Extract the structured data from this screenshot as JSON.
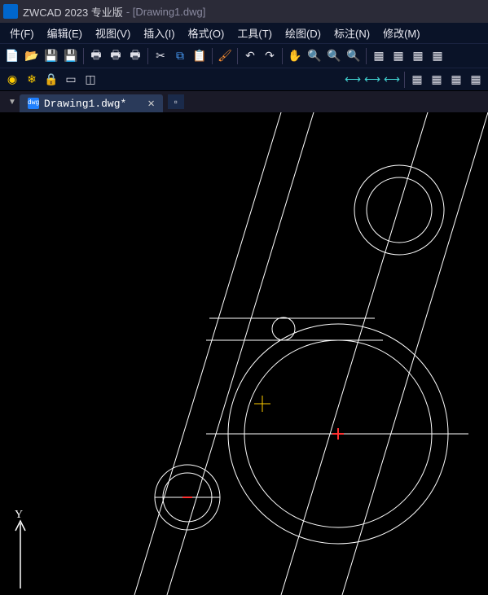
{
  "app": {
    "title": "ZWCAD 2023 专业版",
    "document_suffix": "- [Drawing1.dwg]"
  },
  "menus": [
    {
      "label": "件(F)"
    },
    {
      "label": "编辑(E)"
    },
    {
      "label": "视图(V)"
    },
    {
      "label": "插入(I)"
    },
    {
      "label": "格式(O)"
    },
    {
      "label": "工具(T)"
    },
    {
      "label": "绘图(D)"
    },
    {
      "label": "标注(N)"
    },
    {
      "label": "修改(M)"
    }
  ],
  "tab": {
    "name": "Drawing1.dwg*",
    "close": "✕"
  },
  "toolbar1_icons": [
    {
      "name": "new-icon",
      "glyph": "📄",
      "cls": "c-white"
    },
    {
      "name": "open-icon",
      "glyph": "📂",
      "cls": "c-yellow"
    },
    {
      "name": "save-icon",
      "glyph": "💾",
      "cls": "c-blue"
    },
    {
      "name": "saveas-icon",
      "glyph": "💾",
      "cls": "c-blue"
    },
    {
      "name": "sep"
    },
    {
      "name": "plot-icon",
      "glyph": "🖶",
      "cls": "c-white"
    },
    {
      "name": "preview-icon",
      "glyph": "🖶",
      "cls": "c-white"
    },
    {
      "name": "publish-icon",
      "glyph": "🖶",
      "cls": "c-white"
    },
    {
      "name": "sep"
    },
    {
      "name": "cut-icon",
      "glyph": "✂",
      "cls": "c-white"
    },
    {
      "name": "copy-icon",
      "glyph": "⧉",
      "cls": "c-blue"
    },
    {
      "name": "paste-icon",
      "glyph": "📋",
      "cls": "c-yellow"
    },
    {
      "name": "sep"
    },
    {
      "name": "matchprop-icon",
      "glyph": "🖌",
      "cls": "c-orange"
    },
    {
      "name": "sep"
    },
    {
      "name": "undo-icon",
      "glyph": "↶",
      "cls": "c-white"
    },
    {
      "name": "redo-icon",
      "glyph": "↷",
      "cls": "c-white"
    },
    {
      "name": "sep"
    },
    {
      "name": "pan-icon",
      "glyph": "✋",
      "cls": "c-yellow"
    },
    {
      "name": "zoom-realtime-icon",
      "glyph": "🔍",
      "cls": "c-white"
    },
    {
      "name": "zoom-window-icon",
      "glyph": "🔍",
      "cls": "c-white"
    },
    {
      "name": "zoom-prev-icon",
      "glyph": "🔍",
      "cls": "c-white"
    },
    {
      "name": "sep"
    },
    {
      "name": "properties-icon",
      "glyph": "▦",
      "cls": "c-white"
    },
    {
      "name": "designcenter-icon",
      "glyph": "▦",
      "cls": "c-white"
    },
    {
      "name": "toolpalette-icon",
      "glyph": "▦",
      "cls": "c-white"
    },
    {
      "name": "calc-icon",
      "glyph": "▦",
      "cls": "c-white"
    }
  ],
  "toolbar2_icons": [
    {
      "name": "layer-off-icon",
      "glyph": "◉",
      "cls": "c-yellow"
    },
    {
      "name": "layer-freeze-icon",
      "glyph": "❄",
      "cls": "c-yellow"
    },
    {
      "name": "layer-lock-icon",
      "glyph": "🔒",
      "cls": "c-blue"
    },
    {
      "name": "layer-state-icon",
      "glyph": "▭",
      "cls": "c-white"
    },
    {
      "name": "layer-color-icon",
      "glyph": "◫",
      "cls": "c-white"
    }
  ],
  "toolbar_right_icons": [
    {
      "name": "dim-icon-1",
      "glyph": "⟷",
      "cls": "c-cyan"
    },
    {
      "name": "dim-icon-2",
      "glyph": "⟷",
      "cls": "c-cyan"
    },
    {
      "name": "dim-icon-3",
      "glyph": "⟷",
      "cls": "c-cyan"
    },
    {
      "name": "sep"
    },
    {
      "name": "block-icon-1",
      "glyph": "▦",
      "cls": "c-white"
    },
    {
      "name": "block-icon-2",
      "glyph": "▦",
      "cls": "c-white"
    },
    {
      "name": "block-icon-3",
      "glyph": "▦",
      "cls": "c-white"
    },
    {
      "name": "block-icon-4",
      "glyph": "▦",
      "cls": "c-white"
    }
  ],
  "ucs": {
    "y_label": "Y"
  }
}
